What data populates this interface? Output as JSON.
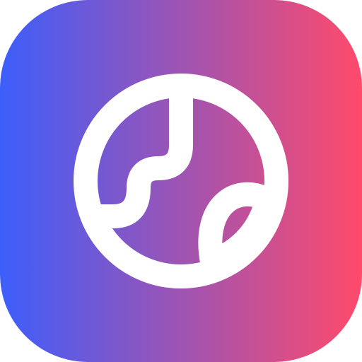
{
  "icon": {
    "name": "globe-icon",
    "gradient": {
      "from": "#3d5efb",
      "to": "#ff4a6b",
      "direction": "horizontal"
    },
    "glyph_color": "#ffffff"
  }
}
